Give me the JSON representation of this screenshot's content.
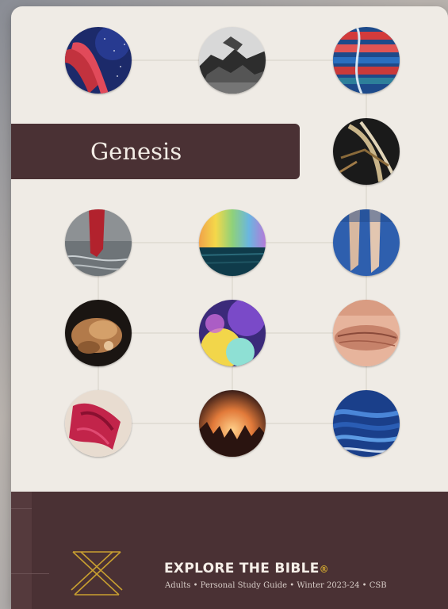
{
  "cover": {
    "title": "Genesis",
    "brand": "EXPLORE THE BIBLE",
    "brand_mark": "®",
    "subtitle": "Adults • Personal Study Guide • Winter 2023-24 • CSB"
  },
  "colors": {
    "background": "#efebe5",
    "band": "#4a3134",
    "title_text": "#f3ede6",
    "logo_gold": "#c9a030"
  },
  "photos": [
    {
      "name": "photo-red-fabric-space",
      "theme": "red cloth on starry blue"
    },
    {
      "name": "photo-rocky-shore-bw",
      "theme": "black and white rocks"
    },
    {
      "name": "photo-striped-textile",
      "theme": "red and blue woven stripes"
    },
    {
      "name": "photo-bird-feathers",
      "theme": "feathers and branches"
    },
    {
      "name": "photo-red-cloth-water",
      "theme": "red cloth in water"
    },
    {
      "name": "photo-rainbow-sea",
      "theme": "rainbow over sea"
    },
    {
      "name": "photo-ballet-feet",
      "theme": "pointe shoes on blue"
    },
    {
      "name": "photo-clay-pottery",
      "theme": "clay hands"
    },
    {
      "name": "photo-colorful-powder",
      "theme": "purple and yellow powder"
    },
    {
      "name": "photo-skin-closeup",
      "theme": "skin close-up"
    },
    {
      "name": "photo-pink-fabric",
      "theme": "pink draped fabric"
    },
    {
      "name": "photo-sunset-trees",
      "theme": "sunset through trees"
    },
    {
      "name": "photo-blue-wave-texture",
      "theme": "blue wavy texture"
    }
  ]
}
